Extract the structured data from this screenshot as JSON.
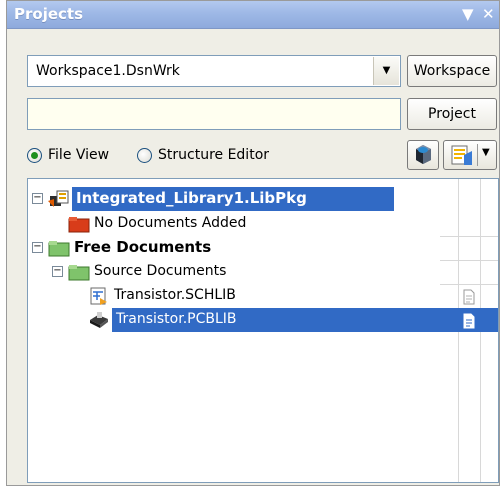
{
  "panel": {
    "title": "Projects",
    "menu_glyph": "▼",
    "close_glyph": "✕"
  },
  "workspace": {
    "combo_value": "Workspace1.DsnWrk",
    "button_label": "Workspace"
  },
  "project": {
    "input_value": "",
    "button_label": "Project"
  },
  "view_mode": {
    "options": [
      {
        "label": "File View",
        "selected": true
      },
      {
        "label": "Structure Editor",
        "selected": false
      }
    ]
  },
  "toolbar": {
    "icons": [
      "project-manager-icon",
      "document-options-icon",
      "dropdown-arrow-icon"
    ]
  },
  "tree": {
    "items": [
      {
        "label": "Integrated_Library1.LibPkg",
        "icon": "integrated-library-icon",
        "selected": true
      },
      {
        "label": "No Documents Added",
        "icon": "red-folder-icon"
      },
      {
        "label": "Free Documents",
        "icon": "green-folder-icon"
      },
      {
        "label": "Source Documents",
        "icon": "green-folder-icon"
      },
      {
        "label": "Transistor.SCHLIB",
        "icon": "schematic-library-icon"
      },
      {
        "label": "Transistor.PCBLIB",
        "icon": "pcb-library-icon",
        "selected": true
      }
    ]
  },
  "colors": {
    "selection": "#316ac5",
    "titlebar": "#9eb8e6",
    "panel_bg": "#efeee6"
  }
}
